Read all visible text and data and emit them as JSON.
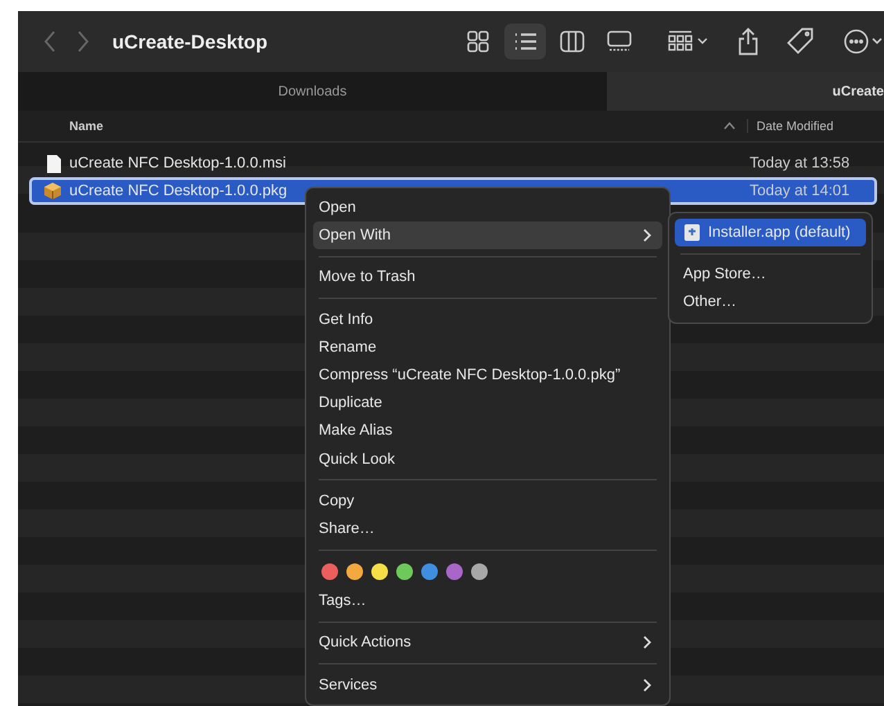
{
  "window": {
    "title": "uCreate-Desktop"
  },
  "toolbar": {
    "view_buttons": [
      {
        "kind": "icons",
        "selected": false
      },
      {
        "kind": "list",
        "selected": true
      },
      {
        "kind": "columns",
        "selected": false
      },
      {
        "kind": "gallery",
        "selected": false
      }
    ]
  },
  "tabs": [
    {
      "label": "Downloads",
      "selected": false
    },
    {
      "label": "uCreate",
      "selected": true
    }
  ],
  "table": {
    "columns": [
      {
        "label": "Name",
        "sorted": true
      },
      {
        "label": "Date Modified",
        "sorted": false
      }
    ],
    "rows": [
      {
        "name": "uCreate NFC Desktop-1.0.0.msi",
        "date": "Today at 13:58",
        "kind": "document",
        "selected": false
      },
      {
        "name": "uCreate NFC Desktop-1.0.0.pkg",
        "date": "Today at 14:01",
        "kind": "package",
        "selected": true
      }
    ]
  },
  "context_menu": {
    "items": [
      {
        "kind": "item",
        "label": "Open",
        "selected": false
      },
      {
        "kind": "submenu",
        "label": "Open With",
        "selected": true
      },
      {
        "kind": "separator"
      },
      {
        "kind": "item",
        "label": "Move to Trash",
        "selected": false
      },
      {
        "kind": "separator"
      },
      {
        "kind": "item",
        "label": "Get Info",
        "selected": false
      },
      {
        "kind": "item",
        "label": "Rename",
        "selected": false
      },
      {
        "kind": "item",
        "label": "Compress “uCreate NFC Desktop-1.0.0.pkg”",
        "selected": false
      },
      {
        "kind": "item",
        "label": "Duplicate",
        "selected": false
      },
      {
        "kind": "item",
        "label": "Make Alias",
        "selected": false
      },
      {
        "kind": "item",
        "label": "Quick Look",
        "selected": false
      },
      {
        "kind": "separator"
      },
      {
        "kind": "item",
        "label": "Copy",
        "selected": false
      },
      {
        "kind": "item",
        "label": "Share…",
        "selected": false
      },
      {
        "kind": "separator"
      },
      {
        "kind": "tags",
        "tags": [
          {
            "color": "#ec5f5c"
          },
          {
            "color": "#f3a93d"
          },
          {
            "color": "#f5de48"
          },
          {
            "color": "#6cc95a"
          },
          {
            "color": "#3f8ee0"
          },
          {
            "color": "#a867c8"
          },
          {
            "color": "#a8a8a8"
          }
        ]
      },
      {
        "kind": "item",
        "label": "Tags…",
        "selected": false
      },
      {
        "kind": "separator"
      },
      {
        "kind": "submenu",
        "label": "Quick Actions",
        "selected": false
      },
      {
        "kind": "separator"
      },
      {
        "kind": "submenu",
        "label": "Services",
        "selected": false
      }
    ]
  },
  "submenu": {
    "items": [
      {
        "kind": "app",
        "label": "Installer.app (default)",
        "selected": true
      },
      {
        "kind": "separator"
      },
      {
        "kind": "item",
        "label": "App Store…",
        "selected": false
      },
      {
        "kind": "item",
        "label": "Other…",
        "selected": false
      }
    ]
  }
}
